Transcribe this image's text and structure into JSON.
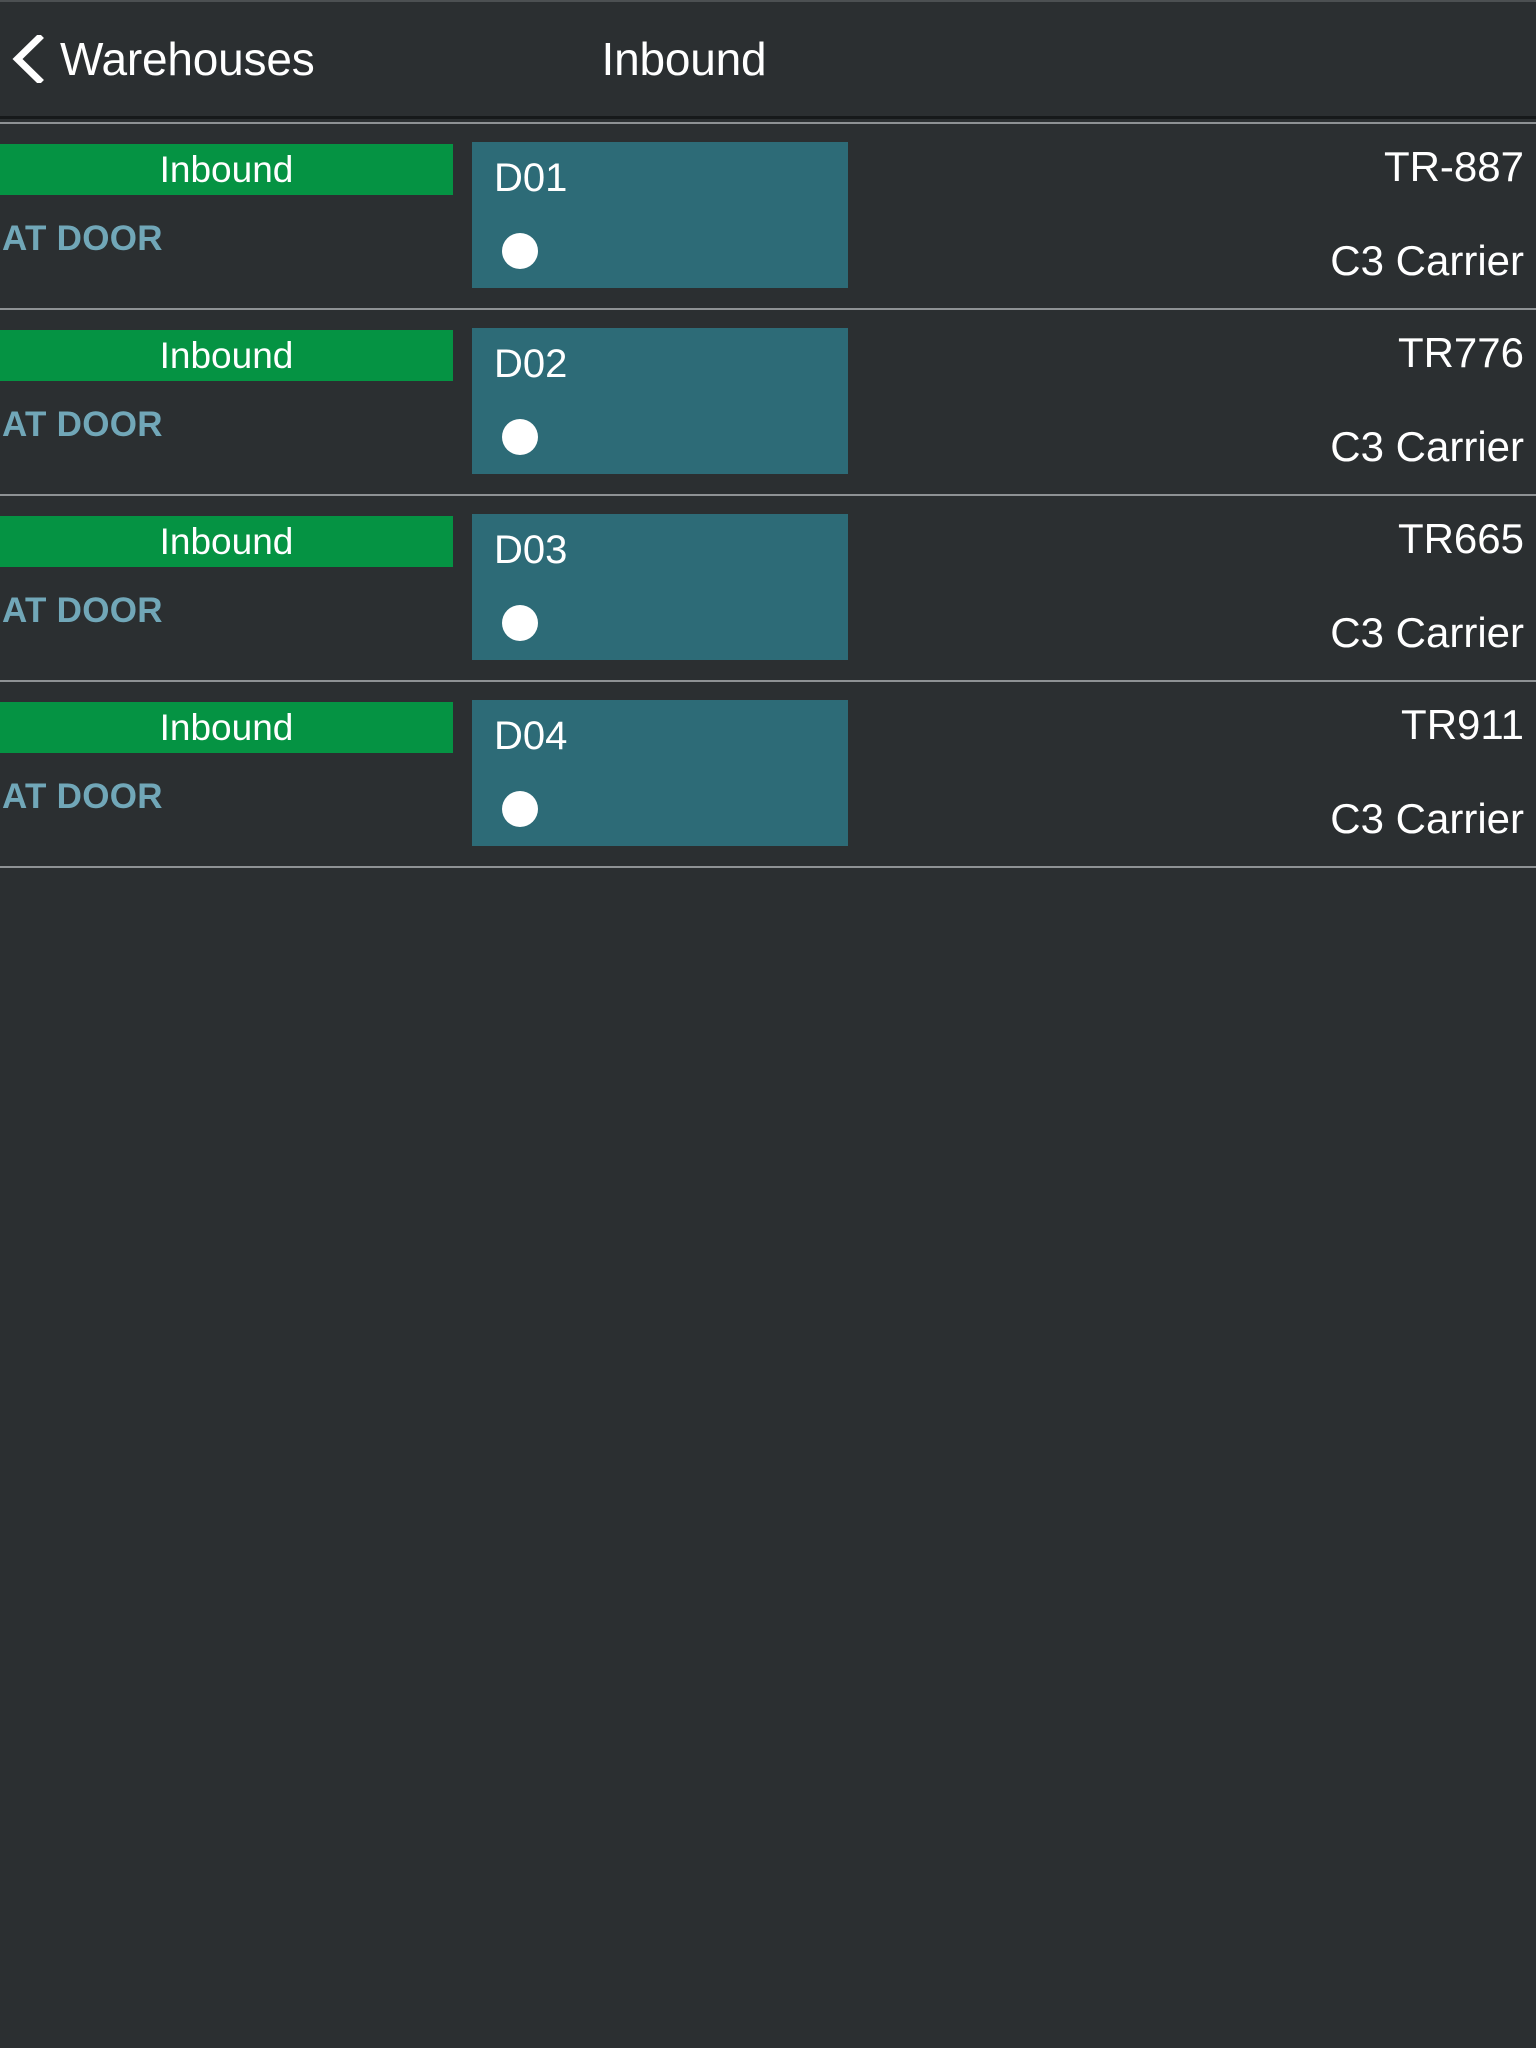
{
  "nav": {
    "back_label": "Warehouses",
    "back_icon": "chevron-left-icon",
    "title": "Inbound"
  },
  "colors": {
    "background": "#2b2f31",
    "row_separator": "#8e9294",
    "inbound_green": "#059343",
    "door_tile_teal": "#2d6b77",
    "state_label_blue": "#71a7b8",
    "text_white": "#ffffff"
  },
  "list": {
    "rows": [
      {
        "direction": "Inbound",
        "state": "AT DOOR",
        "door": "D01",
        "door_indicator": "occupied-dot-icon",
        "trailer_id": "TR-887",
        "carrier": "C3 Carrier"
      },
      {
        "direction": "Inbound",
        "state": "AT DOOR",
        "door": "D02",
        "door_indicator": "occupied-dot-icon",
        "trailer_id": "TR776",
        "carrier": "C3 Carrier"
      },
      {
        "direction": "Inbound",
        "state": "AT DOOR",
        "door": "D03",
        "door_indicator": "occupied-dot-icon",
        "trailer_id": "TR665",
        "carrier": "C3 Carrier"
      },
      {
        "direction": "Inbound",
        "state": "AT DOOR",
        "door": "D04",
        "door_indicator": "occupied-dot-icon",
        "trailer_id": "TR911",
        "carrier": "C3 Carrier"
      }
    ]
  }
}
